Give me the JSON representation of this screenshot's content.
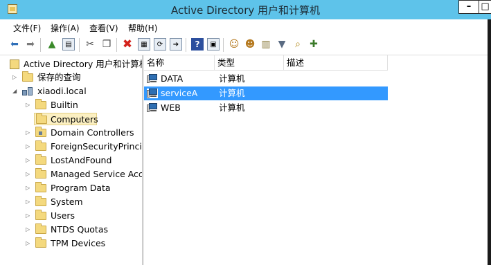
{
  "window": {
    "title": "Active Directory 用户和计算机",
    "minimize_glyph": "–",
    "maximize_glyph": "□"
  },
  "menu": [
    "文件(F)",
    "操作(A)",
    "查看(V)",
    "帮助(H)"
  ],
  "toolbar": {
    "icons": [
      "back-arrow",
      "forward-arrow",
      "up-folder",
      "show-console-tree",
      "cut",
      "copy",
      "delete",
      "properties",
      "refresh",
      "export-list",
      "help",
      "show-action-pane",
      "new-user",
      "new-group",
      "new-ou",
      "filter",
      "find",
      "add-to-group"
    ]
  },
  "tree": {
    "root": "Active Directory 用户和计算机",
    "saved_queries": "保存的查询",
    "domain": "xiaodi.local",
    "children": [
      "Builtin",
      "Computers",
      "Domain Controllers",
      "ForeignSecurityPrincipa",
      "LostAndFound",
      "Managed Service Accc",
      "Program Data",
      "System",
      "Users",
      "NTDS Quotas",
      "TPM Devices"
    ],
    "selected": "Computers"
  },
  "list": {
    "columns": [
      "名称",
      "类型",
      "描述"
    ],
    "rows": [
      {
        "name": "DATA",
        "type": "计算机",
        "desc": ""
      },
      {
        "name": "serviceA",
        "type": "计算机",
        "desc": ""
      },
      {
        "name": "WEB",
        "type": "计算机",
        "desc": ""
      }
    ],
    "selected_row": "serviceA"
  },
  "colors": {
    "titlebar": "#5ec3ea",
    "selection": "#3399ff",
    "tree_selection": "#fcf0c2"
  }
}
